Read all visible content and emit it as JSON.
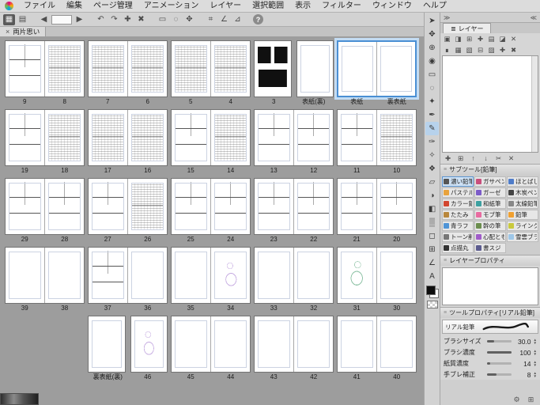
{
  "menu": {
    "items": [
      "ファイル",
      "編集",
      "ページ管理",
      "アニメーション",
      "レイヤー",
      "選択範囲",
      "表示",
      "フィルター",
      "ウィンドウ",
      "ヘルプ"
    ]
  },
  "toolbar": {
    "buttons": [
      {
        "name": "page-manager-view-button",
        "glyph": "▦",
        "active": true
      },
      {
        "name": "single-page-view-button",
        "glyph": "▤"
      },
      {
        "name": "sep1",
        "kind": "sep"
      },
      {
        "name": "prev-page-button",
        "glyph": "◀"
      },
      {
        "name": "page-number-box",
        "kind": "box"
      },
      {
        "name": "next-page-button",
        "glyph": "▶"
      },
      {
        "name": "sep2",
        "kind": "sep"
      },
      {
        "name": "undo-button",
        "glyph": "↶"
      },
      {
        "name": "redo-button",
        "glyph": "↷"
      },
      {
        "name": "add-page-button",
        "glyph": "✚"
      },
      {
        "name": "delete-page-button",
        "glyph": "✖"
      },
      {
        "name": "sep3",
        "kind": "sep"
      },
      {
        "name": "rect-select-button",
        "glyph": "▭"
      },
      {
        "name": "lasso-select-button",
        "glyph": "◌"
      },
      {
        "name": "move-button",
        "glyph": "✥"
      },
      {
        "name": "sep4",
        "kind": "sep"
      },
      {
        "name": "grid-button",
        "glyph": "⌗"
      },
      {
        "name": "ruler-button",
        "glyph": "∠"
      },
      {
        "name": "snap-button",
        "glyph": "⊿"
      },
      {
        "name": "sep5",
        "kind": "sep"
      },
      {
        "name": "help-button",
        "glyph": "?",
        "kind": "help"
      }
    ]
  },
  "tab": {
    "close": "×",
    "title": "両片思い"
  },
  "page_manager": {
    "rows": [
      {
        "cells": [
          {
            "type": "spread",
            "pages": [
              {
                "label": "9",
                "pat": "panels"
              },
              {
                "label": "8",
                "pat": "dense"
              }
            ]
          },
          {
            "type": "spread",
            "pages": [
              {
                "label": "7",
                "pat": "dense"
              },
              {
                "label": "6",
                "pat": "dense"
              }
            ]
          },
          {
            "type": "spread",
            "pages": [
              {
                "label": "5",
                "pat": "dense"
              },
              {
                "label": "4",
                "pat": "dense"
              }
            ]
          },
          {
            "type": "singles",
            "pages": [
              {
                "label": "3",
                "pat": "black"
              },
              {
                "label": "表紙(裏)",
                "pat": "frame"
              }
            ]
          },
          {
            "type": "spread",
            "selected": true,
            "pages": [
              {
                "label": "表紙",
                "pat": "frame"
              },
              {
                "label": "裏表紙",
                "pat": "frame"
              }
            ]
          }
        ]
      },
      {
        "cells": [
          {
            "type": "spread",
            "pages": [
              {
                "label": "19",
                "pat": "panels"
              },
              {
                "label": "18",
                "pat": "dense"
              }
            ]
          },
          {
            "type": "spread",
            "pages": [
              {
                "label": "17",
                "pat": "dense"
              },
              {
                "label": "16",
                "pat": "dense"
              }
            ]
          },
          {
            "type": "spread",
            "pages": [
              {
                "label": "15",
                "pat": "panels"
              },
              {
                "label": "14",
                "pat": "dense"
              }
            ]
          },
          {
            "type": "spread",
            "pages": [
              {
                "label": "13",
                "pat": "panels"
              },
              {
                "label": "12",
                "pat": "panels"
              }
            ]
          },
          {
            "type": "spread",
            "pages": [
              {
                "label": "11",
                "pat": "panels"
              },
              {
                "label": "10",
                "pat": "dense"
              }
            ]
          }
        ]
      },
      {
        "cells": [
          {
            "type": "spread",
            "pages": [
              {
                "label": "29",
                "pat": "panels"
              },
              {
                "label": "28",
                "pat": "panels"
              }
            ]
          },
          {
            "type": "spread",
            "pages": [
              {
                "label": "27",
                "pat": "panels"
              },
              {
                "label": "26",
                "pat": "dense"
              }
            ]
          },
          {
            "type": "spread",
            "pages": [
              {
                "label": "25",
                "pat": "panels"
              },
              {
                "label": "24",
                "pat": "panels"
              }
            ]
          },
          {
            "type": "spread",
            "pages": [
              {
                "label": "23",
                "pat": "panels"
              },
              {
                "label": "22",
                "pat": "panels"
              }
            ]
          },
          {
            "type": "spread",
            "pages": [
              {
                "label": "21",
                "pat": "panels"
              },
              {
                "label": "20",
                "pat": "panels"
              }
            ]
          }
        ]
      },
      {
        "cells": [
          {
            "type": "spread",
            "pages": [
              {
                "label": "39",
                "pat": "frame"
              },
              {
                "label": "38",
                "pat": "frame"
              }
            ]
          },
          {
            "type": "spread",
            "pages": [
              {
                "label": "37",
                "pat": "panels"
              },
              {
                "label": "36",
                "pat": "frame"
              }
            ]
          },
          {
            "type": "spread",
            "pages": [
              {
                "label": "35",
                "pat": "frame"
              },
              {
                "label": "34",
                "pat": "sketchP"
              }
            ]
          },
          {
            "type": "spread",
            "pages": [
              {
                "label": "33",
                "pat": "frame"
              },
              {
                "label": "32",
                "pat": "frame"
              }
            ]
          },
          {
            "type": "spread",
            "pages": [
              {
                "label": "31",
                "pat": "sketchG"
              },
              {
                "label": "30",
                "pat": "frame"
              }
            ]
          }
        ]
      },
      {
        "cells": [
          {
            "type": "empty"
          },
          {
            "type": "singles",
            "pages": [
              {
                "label": "裏表紙(裏)",
                "pat": "frame"
              },
              {
                "label": "46",
                "pat": "sketchP"
              }
            ]
          },
          {
            "type": "spread",
            "pages": [
              {
                "label": "45",
                "pat": "frame"
              },
              {
                "label": "44",
                "pat": "frame"
              }
            ]
          },
          {
            "type": "spread",
            "pages": [
              {
                "label": "43",
                "pat": "frame"
              },
              {
                "label": "42",
                "pat": "frame"
              }
            ]
          },
          {
            "type": "spread",
            "pages": [
              {
                "label": "41",
                "pat": "frame"
              },
              {
                "label": "40",
                "pat": "frame"
              }
            ]
          }
        ]
      }
    ]
  },
  "tools": {
    "items": [
      {
        "name": "operation-tool",
        "glyph": "➤"
      },
      {
        "name": "move-tool",
        "glyph": "✥"
      },
      {
        "name": "zoom-tool",
        "glyph": "⊕"
      },
      {
        "name": "eyedropper-tool",
        "glyph": "◉"
      },
      {
        "name": "select-tool",
        "glyph": "▭"
      },
      {
        "name": "lasso-tool",
        "glyph": "◌"
      },
      {
        "name": "wand-tool",
        "glyph": "✦"
      },
      {
        "name": "pen-tool",
        "glyph": "✒"
      },
      {
        "name": "pencil-tool",
        "glyph": "✎",
        "selected": true
      },
      {
        "name": "brush-tool",
        "glyph": "✑"
      },
      {
        "name": "airbrush-tool",
        "glyph": "✧"
      },
      {
        "name": "decoration-tool",
        "glyph": "❖"
      },
      {
        "name": "eraser-tool",
        "glyph": "▱"
      },
      {
        "name": "blend-tool",
        "glyph": "◑"
      },
      {
        "name": "fill-tool",
        "glyph": "◧"
      },
      {
        "name": "gradient-tool",
        "glyph": "▒"
      },
      {
        "name": "figure-tool",
        "glyph": "◻"
      },
      {
        "name": "frame-border-tool",
        "glyph": "⊞"
      },
      {
        "name": "ruler-tool",
        "glyph": "∠"
      },
      {
        "name": "text-tool",
        "glyph": "A"
      }
    ]
  },
  "panels": {
    "dock": {
      "left": "≫",
      "right": "≪"
    },
    "layer": {
      "title": "レイヤー",
      "tab_icon": "≣",
      "icon_rows": [
        [
          {
            "name": "blend-mode-icon",
            "glyph": "▣"
          },
          {
            "name": "new-raster-layer-icon",
            "glyph": "◨"
          },
          {
            "name": "new-folder-icon",
            "glyph": "⊞"
          },
          {
            "name": "add-layer-icon",
            "glyph": "✚"
          },
          {
            "name": "mask-icon",
            "glyph": "▤"
          },
          {
            "name": "clip-icon",
            "glyph": "◪"
          },
          {
            "name": "delete-layer-icon",
            "glyph": "✕"
          }
        ],
        [
          {
            "name": "lock-layer-icon",
            "glyph": "∎"
          },
          {
            "name": "lock-pixel-icon",
            "glyph": "▦"
          },
          {
            "name": "ruler-layer-icon",
            "glyph": "▧"
          },
          {
            "name": "set-reference-icon",
            "glyph": "⊟"
          },
          {
            "name": "tone-layer-icon",
            "glyph": "▨"
          },
          {
            "name": "merge-icon",
            "glyph": "✚"
          },
          {
            "name": "clear-icon",
            "glyph": "✖"
          }
        ]
      ],
      "bottom_icons": [
        {
          "name": "new-layer-icon",
          "glyph": "✚"
        },
        {
          "name": "new-group-icon",
          "glyph": "⊞"
        },
        {
          "name": "move-up-icon",
          "glyph": "↑"
        },
        {
          "name": "move-down-icon",
          "glyph": "↓"
        },
        {
          "name": "cut-icon",
          "glyph": "✂"
        },
        {
          "name": "trash-icon",
          "glyph": "✕"
        }
      ]
    },
    "subtool": {
      "title": "サブツール[鉛筆]",
      "items": [
        {
          "label": "濃い鉛筆",
          "color": "#555555",
          "selected": true
        },
        {
          "label": "ガサペン",
          "color": "#c94f7c"
        },
        {
          "label": "ほとばし",
          "color": "#4f7cc9"
        },
        {
          "label": "パステル",
          "color": "#e8a33d"
        },
        {
          "label": "ガーゼ",
          "color": "#7c5cc9"
        },
        {
          "label": "木炭ペン",
          "color": "#444444"
        },
        {
          "label": "カラー鉛筆",
          "color": "#d2462f"
        },
        {
          "label": "和紙筆",
          "color": "#3da0a0"
        },
        {
          "label": "太線鉛筆",
          "color": "#888888"
        },
        {
          "label": "たたみ",
          "color": "#b8873d"
        },
        {
          "label": "モブ筆",
          "color": "#e86ba0"
        },
        {
          "label": "鉛筆",
          "color": "#f0a030"
        },
        {
          "label": "青ラフ",
          "color": "#4f94d6"
        },
        {
          "label": "幹の筆",
          "color": "#6b8e4e"
        },
        {
          "label": "ラインク",
          "color": "#c9c93d"
        },
        {
          "label": "トーン削り",
          "color": "#777777"
        },
        {
          "label": "心配とも",
          "color": "#a05cc9"
        },
        {
          "label": "雪雲ブラシ",
          "color": "#9ec7e8"
        },
        {
          "label": "点描丸",
          "color": "#333333"
        },
        {
          "label": "書スジ",
          "color": "#5c5c8e"
        }
      ]
    },
    "layer_property": {
      "title": "レイヤープロパティ"
    },
    "tool_property": {
      "title": "ツールプロパティ[リアル鉛筆]",
      "brush_name": "リアル鉛筆",
      "props": [
        {
          "label": "ブラシサイズ",
          "value": "30.0",
          "fill": 28
        },
        {
          "label": "ブラシ濃度",
          "value": "100",
          "fill": 100
        },
        {
          "label": "紙質濃度",
          "value": "14",
          "fill": 14
        },
        {
          "label": "手ブレ補正",
          "value": "8",
          "fill": 40
        }
      ]
    }
  },
  "statusbar": {
    "icons": [
      {
        "name": "gear-icon",
        "glyph": "⚙"
      },
      {
        "name": "panel-settings-icon",
        "glyph": "⊞"
      }
    ]
  }
}
